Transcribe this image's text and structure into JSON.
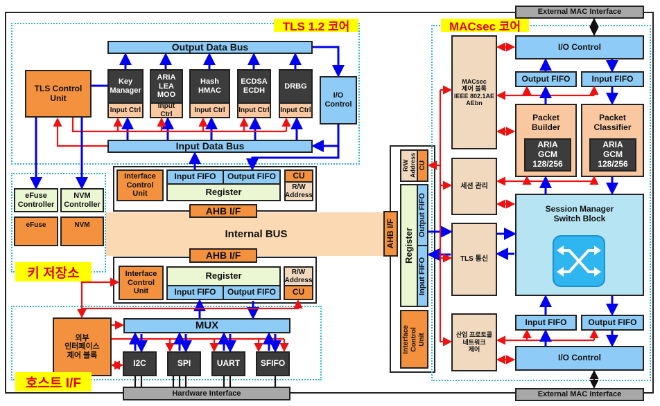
{
  "tls_core": {
    "label": "TLS 1.2 코어",
    "output_bus": "Output Data Bus",
    "input_bus": "Input Data Bus",
    "control_unit": "TLS Control\nUnit",
    "io_control": "I/O\nControl",
    "engines": [
      {
        "name": "Key\nManager",
        "ctrl": "Input Ctrl"
      },
      {
        "name": "ARIA\nLEA\nMOO",
        "ctrl": "Input Ctrl"
      },
      {
        "name": "Hash\nHMAC",
        "ctrl": "Input Ctrl"
      },
      {
        "name": "ECDSA\nECDH",
        "ctrl": "Input Ctrl"
      },
      {
        "name": "DRBG",
        "ctrl": "Input Ctrl"
      }
    ]
  },
  "upper_if": {
    "icu": "Interface\nControl\nUnit",
    "input_fifo": "Input FIFO",
    "output_fifo": "Output FIFO",
    "register": "Register",
    "cu": "CU",
    "rw": "R/W\nAddress",
    "ahb": "AHB I/F"
  },
  "internal_bus": "Internal BUS",
  "lower_if": {
    "icu": "Interface\nControl\nUnit",
    "input_fifo": "Input FIFO",
    "output_fifo": "Output FIFO",
    "register": "Register",
    "cu": "CU",
    "rw": "R/W\nAddress",
    "ahb": "AHB I/F"
  },
  "key_store": {
    "label": "키 저장소",
    "efuse_ctrl": "eFuse\nController",
    "nvm_ctrl": "NVM\nController",
    "efuse": "eFuse",
    "nvm": "NVM"
  },
  "host_if": {
    "label": "호스트 I/F",
    "ext_ctrl": "외부\n인터페이스\n제어 블록",
    "mux": "MUX",
    "ports": [
      "I2C",
      "SPI",
      "UART",
      "SFIFO"
    ],
    "hw": "Hardware Interface"
  },
  "right_if": {
    "ahb": "AHB I/F",
    "rw": "R/W\nAddress",
    "cu": "CU",
    "register": "Register",
    "output_fifo": "Output FIFO",
    "input_fifo": "Input FIFO",
    "icu": "Interface\nControl\nUnit"
  },
  "macsec": {
    "label": "MACsec 코어",
    "ext_top": "External MAC Interface",
    "ext_bottom": "External MAC Interface",
    "ctrl_block": "MACsec\n제어 블록\nIEEE 802.1AE\nAEbn",
    "session_mgmt": "세션 관리",
    "tls_comm": "TLS 통신",
    "industrial": "산업 프로토콜\n네트워크\n제어",
    "io_top": "I/O Control",
    "out_fifo_top": "Output FIFO",
    "in_fifo_top": "Input FIFO",
    "builder": "Packet\nBuilder",
    "classifier": "Packet\nClassifier",
    "aria_gcm_1": "ARIA\nGCM\n128/256",
    "aria_gcm_2": "ARIA\nGCM\n128/256",
    "session_manager": "Session Manager\nSwitch Block",
    "in_fifo_bottom": "Input FIFO",
    "out_fifo_bottom": "Output FIFO",
    "io_bottom": "I/O Control"
  },
  "colors": {
    "data_arrow": "#0000ee",
    "control_arrow": "#ee1111",
    "label_bg": "#ffff00",
    "label_text": "#e00000",
    "block_orange": "#f4913f",
    "block_blue": "#8ecbf6"
  }
}
